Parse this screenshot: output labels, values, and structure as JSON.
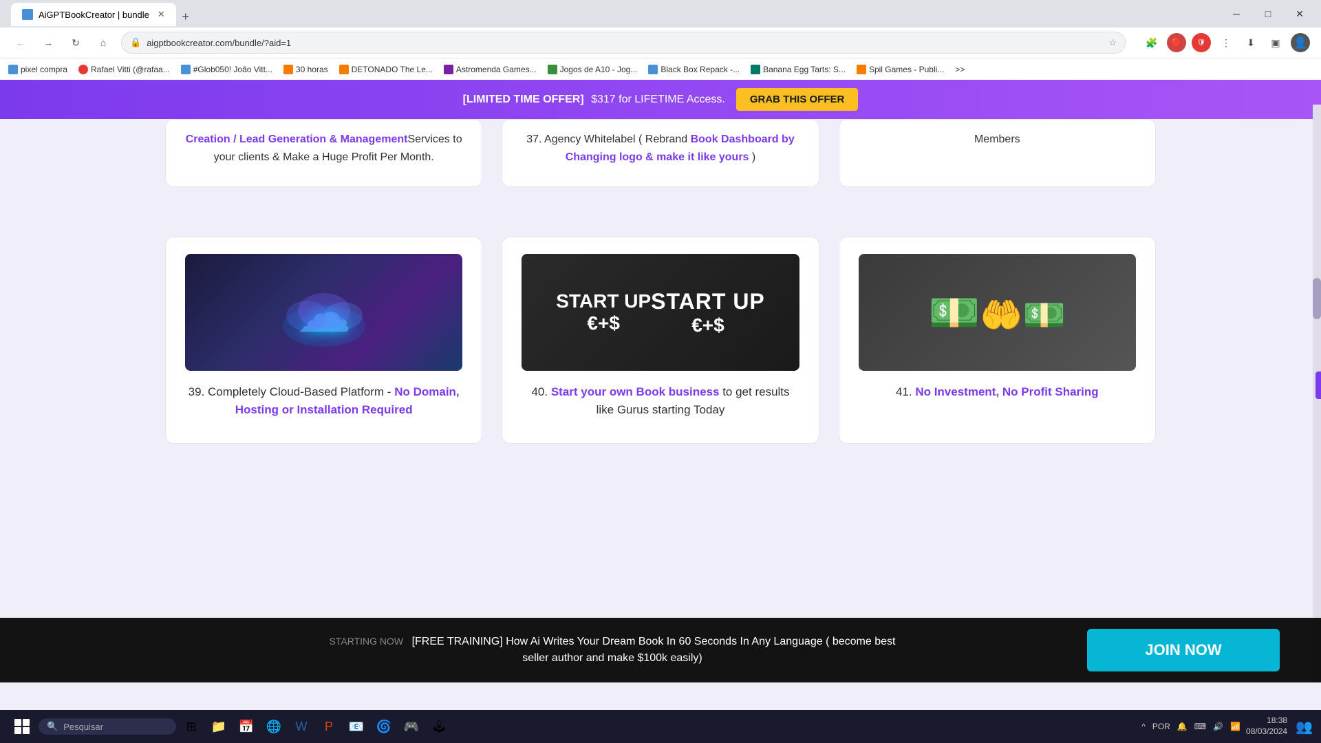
{
  "browser": {
    "tab_title": "AiGPTBookCreator | bundle",
    "tab_favicon": "📚",
    "new_tab_icon": "+",
    "address_url": "aigptbookcreator.com/bundle/?aid=1",
    "bookmarks": [
      {
        "label": "pixel compra",
        "color": "bd-blue"
      },
      {
        "label": "Rafael Vitti (@rafaa...",
        "color": "bd-red"
      },
      {
        "label": "#Glob050! João Vitt...",
        "color": "bd-blue"
      },
      {
        "label": "30 horas",
        "color": "bd-orange"
      },
      {
        "label": "DETONADO The Le...",
        "color": "bd-orange"
      },
      {
        "label": "Astromenda Games...",
        "color": "bd-purple"
      },
      {
        "label": "Jogos de A10 - Jog...",
        "color": "bd-green"
      },
      {
        "label": "Black Box Repack -...",
        "color": "bd-blue"
      },
      {
        "label": "Banana Egg Tarts: S...",
        "color": "bd-teal"
      },
      {
        "label": "Spil Games - Publi...",
        "color": "bd-orange"
      }
    ],
    "more_bookmarks": ">>"
  },
  "promo_banner": {
    "prefix": "[LIMITED TIME OFFER]",
    "text": "$317 for LIFETIME Access.",
    "button_label": "GRAB THIS OFFER"
  },
  "top_cards": [
    {
      "id": "top-card-1",
      "number": "",
      "text_before": "Creation / Lead Generation & Management",
      "highlight": "",
      "text_after": "Services to your clients & Make a Huge Profit Per Month."
    },
    {
      "id": "top-card-2",
      "number": "37.",
      "text_before": "Agency Whitelabel (Rebrand ",
      "highlight": "Book Dashboard by Changing logo & make it like yours",
      "text_after": " )"
    },
    {
      "id": "top-card-3",
      "number": "",
      "highlight": "",
      "text": "Members"
    }
  ],
  "bottom_cards": [
    {
      "id": "card-39",
      "number": "39.",
      "text_before": "Completely Cloud-Based Platform - ",
      "highlight": "No Domain, Hosting or Installation Required",
      "text_after": ""
    },
    {
      "id": "card-40",
      "number": "40.",
      "text_before": "",
      "highlight": "Start your own Book business",
      "text_after": " to get results like Gurus starting Today"
    },
    {
      "id": "card-41",
      "number": "41.",
      "text_before": "",
      "highlight": "No Investment, No Profit Sharing",
      "text_after": ""
    }
  ],
  "notification_bar": {
    "starting_label": "STARTING NOW",
    "text_line1": "[FREE TRAINING] How Ai Writes Your Dream Book In 60 Seconds In Any Language ( become best",
    "text_line2": "seller author and make $100k easily)",
    "button_label": "JOIN NOW"
  },
  "taskbar": {
    "search_placeholder": "Pesquisar",
    "time": "18:38",
    "date": "08/03/2024",
    "language": "POR"
  }
}
